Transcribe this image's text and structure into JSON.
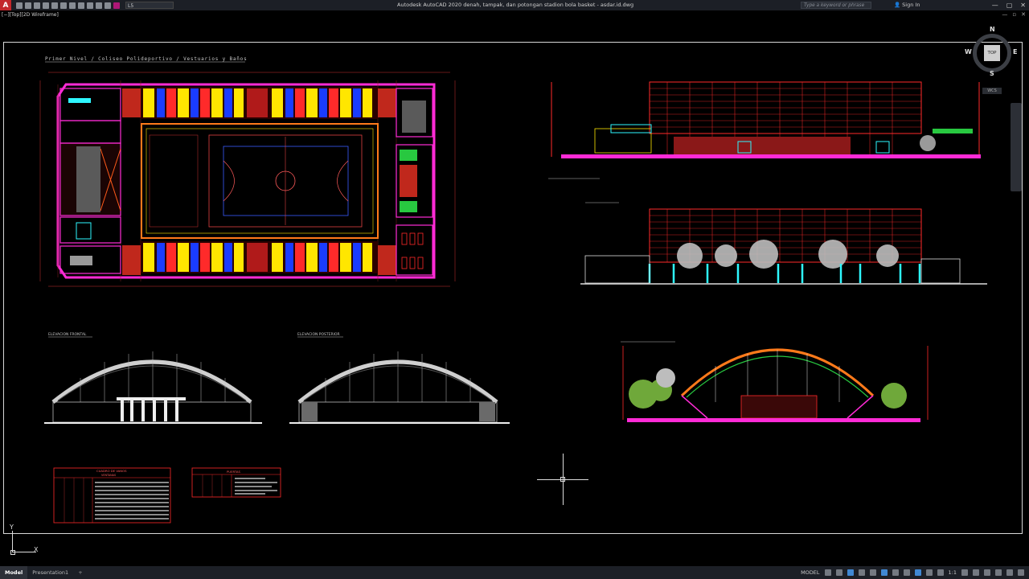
{
  "app": {
    "logo": "A",
    "title": "Autodesk AutoCAD 2020     denah, tampak, dan potongan stadion bola basket - asdar.id.dwg",
    "layer_dropdown": "L5",
    "search_placeholder": "Type a keyword or phrase",
    "sign_in": "Sign In",
    "window_controls": [
      "—",
      "▢",
      "✕"
    ]
  },
  "viewport": {
    "label": "[−][Top][2D Wireframe]",
    "controls": [
      "—",
      "▫",
      "✕"
    ]
  },
  "viewcube": {
    "face": "TOP",
    "north": "N",
    "south": "S",
    "east": "E",
    "west": "W",
    "wcs": "WCS"
  },
  "drawing": {
    "plan_title": "Primer Nivel / Coliseo Polideportivo / Vestuarios y Baños",
    "elev_front_label": "ELEVACION FRONTAL",
    "elev_rear_label": "ELEVACION POSTERIOR",
    "table1_title": "CUADRO DE VANOS",
    "table1_sub": "VENTANAS",
    "table2_title": "PUERTAS"
  },
  "ucs": {
    "x": "X",
    "y": "Y"
  },
  "tabs": [
    "Model",
    "Presentation1",
    "+"
  ],
  "status": {
    "model": "MODEL",
    "scale": "1:1"
  },
  "colors": {
    "magenta": "#ff2bd6",
    "red": "#ff2a2a",
    "yellow": "#ffe600",
    "blue": "#1a3cff",
    "cyan": "#2ef7ff",
    "green": "#28c840",
    "orange": "#ff7a1a"
  }
}
